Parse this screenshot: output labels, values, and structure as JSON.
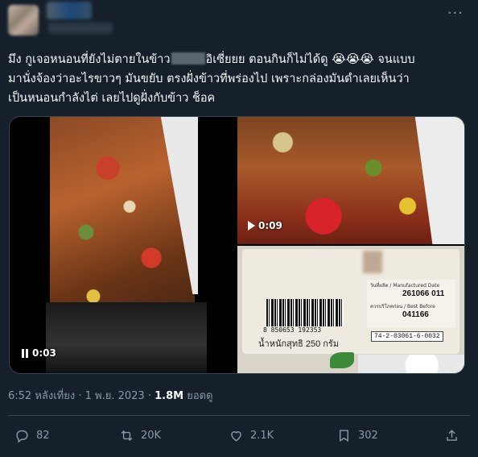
{
  "tweet": {
    "text_line1_a": "มึง กูเจอหนอนที่ยังไม่ตายในข้าว",
    "text_line1_b": "อิเซี่ยยย ตอนกินก็ไม่ได้ดู ",
    "text_line1_emoji": "😭😭😭",
    "text_line1_c": " จนแบบ",
    "text_line2": "มานั่งจ้องว่าอะไรขาวๆ มันขยับ ตรงฝั่งข้าวที่พร่องไป  เพราะกล่องมันดำเลยเห็นว่า",
    "text_line3": "เป็นหนอนกำลังไต่ เลยไปดูฝั่งกับข้าว ช็อค"
  },
  "media": {
    "left_video_time": "0:03",
    "right_video_time": "0:09",
    "label": {
      "barcode_number": "8 850653 192353",
      "weight_text": "น้ำหนักสุทธิ 250 กรัม",
      "mfg_label": "วันที่ผลิต / Manufactured Date",
      "bb_label": "ควรบริโภคก่อน / Best Before",
      "mfg_value": "261066 011",
      "bb_value": "041166",
      "lot_code": "74-2-03061-6-0032"
    }
  },
  "meta": {
    "time": "6:52 หลังเที่ยง",
    "separator": "·",
    "date": "1 พ.ย. 2023",
    "views_count": "1.8M",
    "views_label": "ยอดดู"
  },
  "actions": {
    "replies": "82",
    "retweets": "20K",
    "likes": "2.1K",
    "bookmarks": "302"
  },
  "icons": [
    "more-icon",
    "pause-icon",
    "play-icon",
    "reply-icon",
    "retweet-icon",
    "like-icon",
    "bookmark-icon",
    "share-icon"
  ],
  "colors": {
    "background": "#15202b",
    "text": "#f7f9f9",
    "muted": "#8b98a5",
    "border": "#38444d"
  }
}
